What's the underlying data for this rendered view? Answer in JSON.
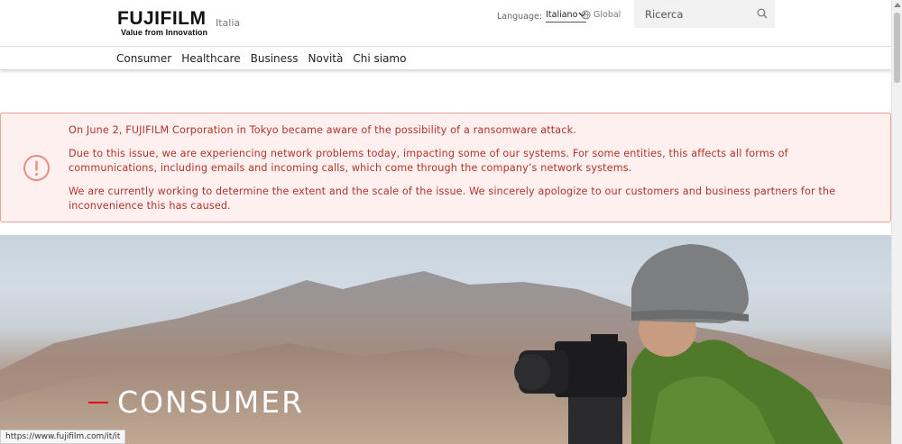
{
  "header": {
    "logo_word": "FUJIFILM",
    "logo_tagline": "Value from Innovation",
    "region": "Italia",
    "language_label": "Language:",
    "language_value": "Italiano",
    "global_label": "Global",
    "search_placeholder": "Ricerca"
  },
  "nav": {
    "items": [
      {
        "label": "Consumer"
      },
      {
        "label": "Healthcare"
      },
      {
        "label": "Business"
      },
      {
        "label": "Novità"
      },
      {
        "label": "Chi siamo"
      }
    ]
  },
  "alert": {
    "p1": "On June 2, FUJIFILM Corporation in Tokyo became aware of the possibility of a ransomware attack.",
    "p2": "Due to this issue, we are experiencing network problems today, impacting some of our systems. For some entities, this affects all forms of communications, including emails and incoming calls, which come through the company’s network systems.",
    "p3": "We are currently working to determine the extent and the scale of the issue. We sincerely apologize to our customers and business partners for the inconvenience this has caused."
  },
  "hero": {
    "title": "CONSUMER"
  },
  "status_bar": {
    "url": "https://www.fujifilm.com/it/it"
  },
  "colors": {
    "brand_red": "#e60012",
    "alert_text": "#b2342c",
    "alert_bg": "#fdf0ee",
    "alert_border": "#e8a29a"
  },
  "icons": {
    "search": "search-icon",
    "globe": "globe-icon",
    "alert": "alert-icon",
    "chevron": "chevron-down-icon"
  }
}
